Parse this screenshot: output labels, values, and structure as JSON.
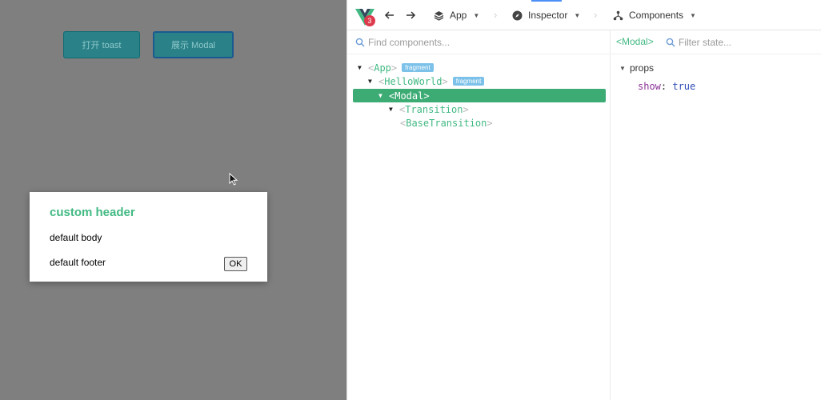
{
  "app": {
    "buttons": {
      "toast": "打开 toast",
      "modal": "展示 Modal"
    },
    "modal": {
      "header": "custom header",
      "body": "default body",
      "footer": "default footer",
      "ok": "OK"
    }
  },
  "devtools": {
    "badge": "3",
    "toolbar": {
      "app_label": "App",
      "inspector_label": "Inspector",
      "components_label": "Components"
    },
    "tree": {
      "search_placeholder": "Find components...",
      "nodes": [
        {
          "name": "App",
          "tag": "fragment"
        },
        {
          "name": "HelloWorld",
          "tag": "fragment"
        },
        {
          "name": "Modal",
          "selected": true
        },
        {
          "name": "Transition"
        },
        {
          "name": "BaseTransition"
        }
      ]
    },
    "state": {
      "selected_component": "<Modal>",
      "filter_placeholder": "Filter state...",
      "section": "props",
      "props": [
        {
          "key": "show",
          "value": "true"
        }
      ]
    }
  },
  "colors": {
    "vue_green": "#42b983",
    "selection": "#3dab74",
    "tag_blue": "#7cc1e9",
    "app_background": "#7f7f7f"
  }
}
